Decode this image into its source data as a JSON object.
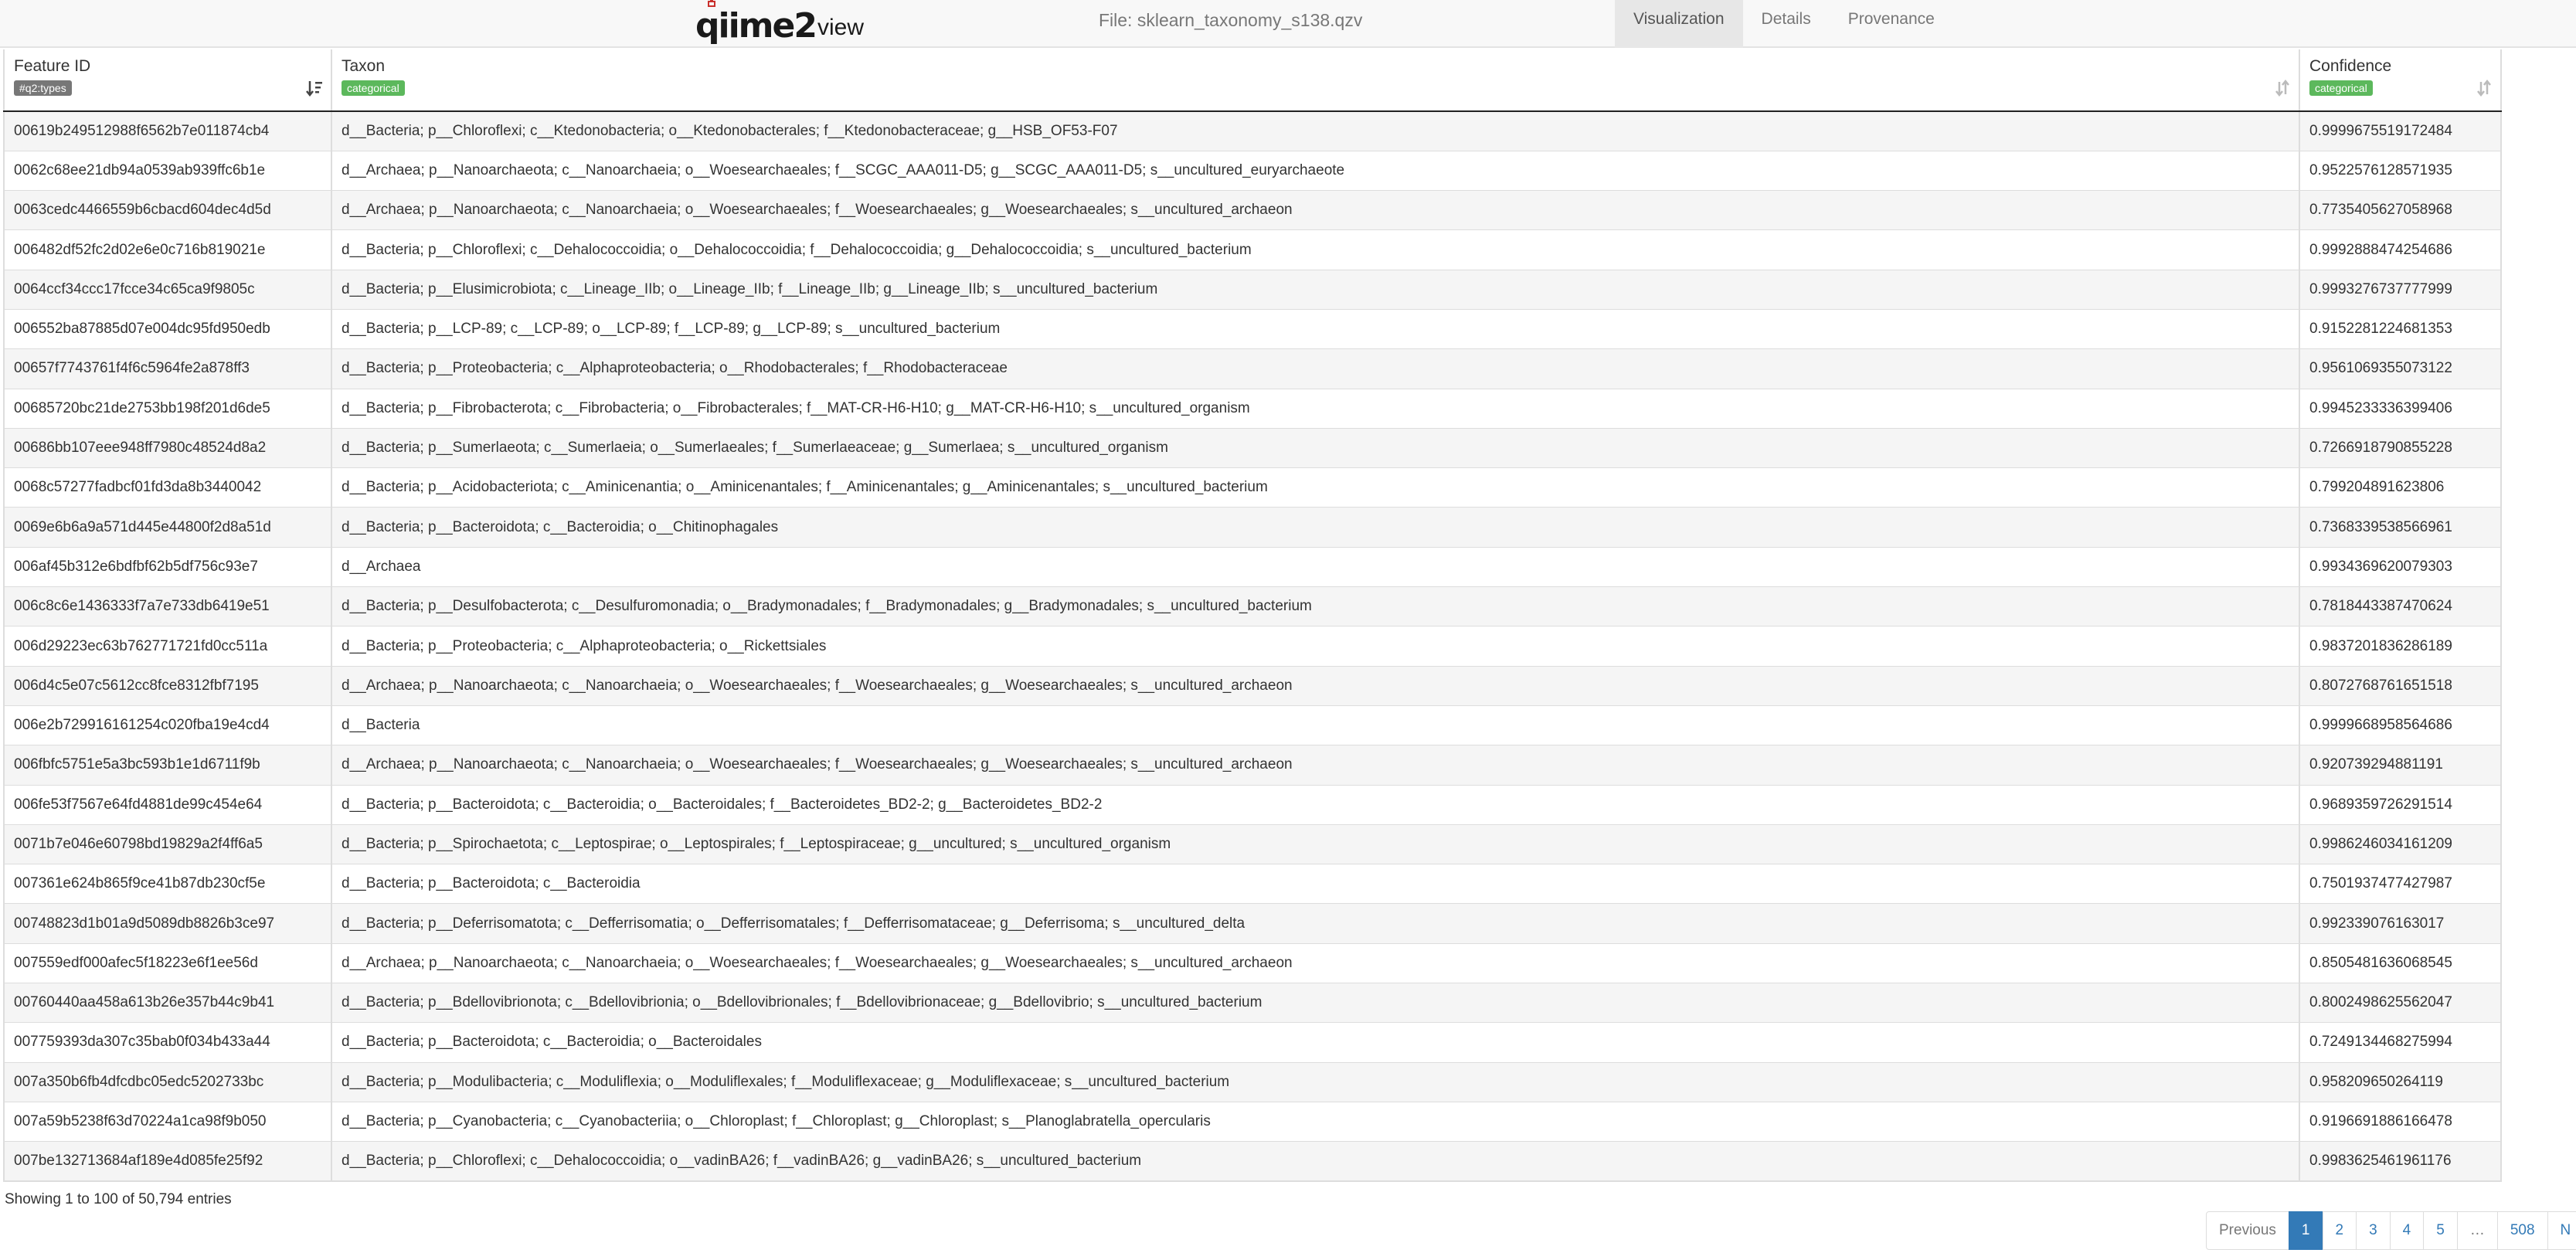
{
  "navbar": {
    "logo_q": "qiime2",
    "logo_suffix": "view",
    "file_prefix": "File:",
    "file_name": "sklearn_taxonomy_s138.qzv",
    "tabs": [
      {
        "label": "Visualization",
        "active": true
      },
      {
        "label": "Details",
        "active": false
      },
      {
        "label": "Provenance",
        "active": false
      }
    ]
  },
  "table": {
    "columns": [
      {
        "label": "Feature ID",
        "badge": "#q2:types",
        "badge_color": "#777777"
      },
      {
        "label": "Taxon",
        "badge": "categorical",
        "badge_color": "#5cb85c"
      },
      {
        "label": "Confidence",
        "badge": "categorical",
        "badge_color": "#5cb85c"
      }
    ],
    "rows": [
      {
        "id": "00619b249512988f6562b7e011874cb4",
        "taxon": "d__Bacteria; p__Chloroflexi; c__Ktedonobacteria; o__Ktedonobacterales; f__Ktedonobacteraceae; g__HSB_OF53-F07",
        "confidence": "0.9999675519172484"
      },
      {
        "id": "0062c68ee21db94a0539ab939ffc6b1e",
        "taxon": "d__Archaea; p__Nanoarchaeota; c__Nanoarchaeia; o__Woesearchaeales; f__SCGC_AAA011-D5; g__SCGC_AAA011-D5; s__uncultured_euryarchaeote",
        "confidence": "0.9522576128571935"
      },
      {
        "id": "0063cedc4466559b6cbacd604dec4d5d",
        "taxon": "d__Archaea; p__Nanoarchaeota; c__Nanoarchaeia; o__Woesearchaeales; f__Woesearchaeales; g__Woesearchaeales; s__uncultured_archaeon",
        "confidence": "0.7735405627058968"
      },
      {
        "id": "006482df52fc2d02e6e0c716b819021e",
        "taxon": "d__Bacteria; p__Chloroflexi; c__Dehalococcoidia; o__Dehalococcoidia; f__Dehalococcoidia; g__Dehalococcoidia; s__uncultured_bacterium",
        "confidence": "0.9992888474254686"
      },
      {
        "id": "0064ccf34ccc17fcce34c65ca9f9805c",
        "taxon": "d__Bacteria; p__Elusimicrobiota; c__Lineage_IIb; o__Lineage_IIb; f__Lineage_IIb; g__Lineage_IIb; s__uncultured_bacterium",
        "confidence": "0.9993276737777999"
      },
      {
        "id": "006552ba87885d07e004dc95fd950edb",
        "taxon": "d__Bacteria; p__LCP-89; c__LCP-89; o__LCP-89; f__LCP-89; g__LCP-89; s__uncultured_bacterium",
        "confidence": "0.9152281224681353"
      },
      {
        "id": "00657f7743761f4f6c5964fe2a878ff3",
        "taxon": "d__Bacteria; p__Proteobacteria; c__Alphaproteobacteria; o__Rhodobacterales; f__Rhodobacteraceae",
        "confidence": "0.9561069355073122"
      },
      {
        "id": "00685720bc21de2753bb198f201d6de5",
        "taxon": "d__Bacteria; p__Fibrobacterota; c__Fibrobacteria; o__Fibrobacterales; f__MAT-CR-H6-H10; g__MAT-CR-H6-H10; s__uncultured_organism",
        "confidence": "0.9945233336399406"
      },
      {
        "id": "00686bb107eee948ff7980c48524d8a2",
        "taxon": "d__Bacteria; p__Sumerlaeota; c__Sumerlaeia; o__Sumerlaeales; f__Sumerlaeaceae; g__Sumerlaea; s__uncultured_organism",
        "confidence": "0.7266918790855228"
      },
      {
        "id": "0068c57277fadbcf01fd3da8b3440042",
        "taxon": "d__Bacteria; p__Acidobacteriota; c__Aminicenantia; o__Aminicenantales; f__Aminicenantales; g__Aminicenantales; s__uncultured_bacterium",
        "confidence": "0.799204891623806"
      },
      {
        "id": "0069e6b6a9a571d445e44800f2d8a51d",
        "taxon": "d__Bacteria; p__Bacteroidota; c__Bacteroidia; o__Chitinophagales",
        "confidence": "0.7368339538566961"
      },
      {
        "id": "006af45b312e6bdfbf62b5df756c93e7",
        "taxon": "d__Archaea",
        "confidence": "0.9934369620079303"
      },
      {
        "id": "006c8c6e1436333f7a7e733db6419e51",
        "taxon": "d__Bacteria; p__Desulfobacterota; c__Desulfuromonadia; o__Bradymonadales; f__Bradymonadales; g__Bradymonadales; s__uncultured_bacterium",
        "confidence": "0.7818443387470624"
      },
      {
        "id": "006d29223ec63b762771721fd0cc511a",
        "taxon": "d__Bacteria; p__Proteobacteria; c__Alphaproteobacteria; o__Rickettsiales",
        "confidence": "0.9837201836286189"
      },
      {
        "id": "006d4c5e07c5612cc8fce8312fbf7195",
        "taxon": "d__Archaea; p__Nanoarchaeota; c__Nanoarchaeia; o__Woesearchaeales; f__Woesearchaeales; g__Woesearchaeales; s__uncultured_archaeon",
        "confidence": "0.8072768761651518"
      },
      {
        "id": "006e2b729916161254c020fba19e4cd4",
        "taxon": "d__Bacteria",
        "confidence": "0.9999668958564686"
      },
      {
        "id": "006fbfc5751e5a3bc593b1e1d6711f9b",
        "taxon": "d__Archaea; p__Nanoarchaeota; c__Nanoarchaeia; o__Woesearchaeales; f__Woesearchaeales; g__Woesearchaeales; s__uncultured_archaeon",
        "confidence": "0.920739294881191"
      },
      {
        "id": "006fe53f7567e64fd4881de99c454e64",
        "taxon": "d__Bacteria; p__Bacteroidota; c__Bacteroidia; o__Bacteroidales; f__Bacteroidetes_BD2-2; g__Bacteroidetes_BD2-2",
        "confidence": "0.9689359726291514"
      },
      {
        "id": "0071b7e046e60798bd19829a2f4ff6a5",
        "taxon": "d__Bacteria; p__Spirochaetota; c__Leptospirae; o__Leptospirales; f__Leptospiraceae; g__uncultured; s__uncultured_organism",
        "confidence": "0.9986246034161209"
      },
      {
        "id": "007361e624b865f9ce41b87db230cf5e",
        "taxon": "d__Bacteria; p__Bacteroidota; c__Bacteroidia",
        "confidence": "0.7501937477427987"
      },
      {
        "id": "00748823d1b01a9d5089db8826b3ce97",
        "taxon": "d__Bacteria; p__Deferrisomatota; c__Defferrisomatia; o__Defferrisomatales; f__Defferrisomataceae; g__Deferrisoma; s__uncultured_delta",
        "confidence": "0.992339076163017"
      },
      {
        "id": "007559edf000afec5f18223e6f1ee56d",
        "taxon": "d__Archaea; p__Nanoarchaeota; c__Nanoarchaeia; o__Woesearchaeales; f__Woesearchaeales; g__Woesearchaeales; s__uncultured_archaeon",
        "confidence": "0.8505481636068545"
      },
      {
        "id": "00760440aa458a613b26e357b44c9b41",
        "taxon": "d__Bacteria; p__Bdellovibrionota; c__Bdellovibrionia; o__Bdellovibrionales; f__Bdellovibrionaceae; g__Bdellovibrio; s__uncultured_bacterium",
        "confidence": "0.8002498625562047"
      },
      {
        "id": "007759393da307c35bab0f034b433a44",
        "taxon": "d__Bacteria; p__Bacteroidota; c__Bacteroidia; o__Bacteroidales",
        "confidence": "0.7249134468275994"
      },
      {
        "id": "007a350b6fb4dfcdbc05edc5202733bc",
        "taxon": "d__Bacteria; p__Modulibacteria; c__Moduliflexia; o__Moduliflexales; f__Moduliflexaceae; g__Moduliflexaceae; s__uncultured_bacterium",
        "confidence": "0.958209650264119"
      },
      {
        "id": "007a59b5238f63d70224a1ca98f9b050",
        "taxon": "d__Bacteria; p__Cyanobacteria; c__Cyanobacteriia; o__Chloroplast; f__Chloroplast; g__Chloroplast; s__Planoglabratella_opercularis",
        "confidence": "0.9196691886166478"
      },
      {
        "id": "007be132713684af189e4d085fe25f92",
        "taxon": "d__Bacteria; p__Chloroflexi; c__Dehalococcoidia; o__vadinBA26; f__vadinBA26; g__vadinBA26; s__uncultured_bacterium",
        "confidence": "0.9983625461961176"
      }
    ]
  },
  "footer": {
    "info": "Showing 1 to 100 of 50,794 entries",
    "pages": [
      {
        "label": "Previous",
        "state": "disabled"
      },
      {
        "label": "1",
        "state": "active"
      },
      {
        "label": "2",
        "state": "normal"
      },
      {
        "label": "3",
        "state": "normal"
      },
      {
        "label": "4",
        "state": "normal"
      },
      {
        "label": "5",
        "state": "normal"
      },
      {
        "label": "…",
        "state": "disabled"
      },
      {
        "label": "508",
        "state": "normal"
      },
      {
        "label": "N",
        "state": "normal"
      }
    ]
  }
}
